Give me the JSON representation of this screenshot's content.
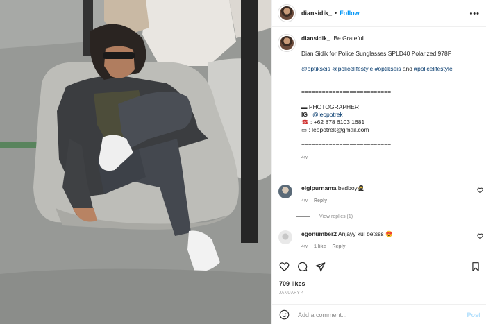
{
  "photo": {
    "alt_subject": "man-on-beanbag"
  },
  "header": {
    "username": "diansidik_",
    "separator": "•",
    "follow_label": "Follow",
    "more_label": "•••"
  },
  "caption": {
    "username": "diansidik_",
    "headline": "Be Gratefull",
    "line_product": "Dian Sidik for Police Sunglasses SPLD40 Polarized 978P",
    "tags": {
      "t1": "@optikseis",
      "t2": "@policelifestyle",
      "t3": "#optikseis",
      "and": "and",
      "t4": "#policelifestyle"
    },
    "divider": "==========================",
    "photographer_label": "PHOTOGRAPHER",
    "ig_label": "IG",
    "ig_sep": " : ",
    "ig_handle": "@leopotrek",
    "phone": ": +62 878 6103 1681",
    "email": ": leopotrek@gmail.com",
    "age": "4w"
  },
  "comments": [
    {
      "username": "elgipurnama",
      "text": "badboy",
      "emoji": "🥷",
      "age": "4w",
      "reply_label": "Reply",
      "view_replies": "View replies (1)"
    },
    {
      "username": "egonumber2",
      "text": "Anjayy kul betsss",
      "emoji": "😍",
      "age": "4w",
      "likes": "1 like",
      "reply_label": "Reply"
    }
  ],
  "actions": {
    "likes": "709 likes",
    "date": "JANUARY 4"
  },
  "add_comment": {
    "placeholder": "Add a comment...",
    "post_label": "Post"
  },
  "colors": {
    "accent": "#0095f6",
    "post_disabled": "#b2dffc",
    "muted": "#8e8e8e"
  },
  "icons": [
    "more-icon",
    "heart-icon",
    "comment-icon",
    "share-icon",
    "bookmark-icon",
    "emoji-icon",
    "small-heart-icon",
    "phone-icon",
    "mail-icon",
    "pointer-icon"
  ]
}
